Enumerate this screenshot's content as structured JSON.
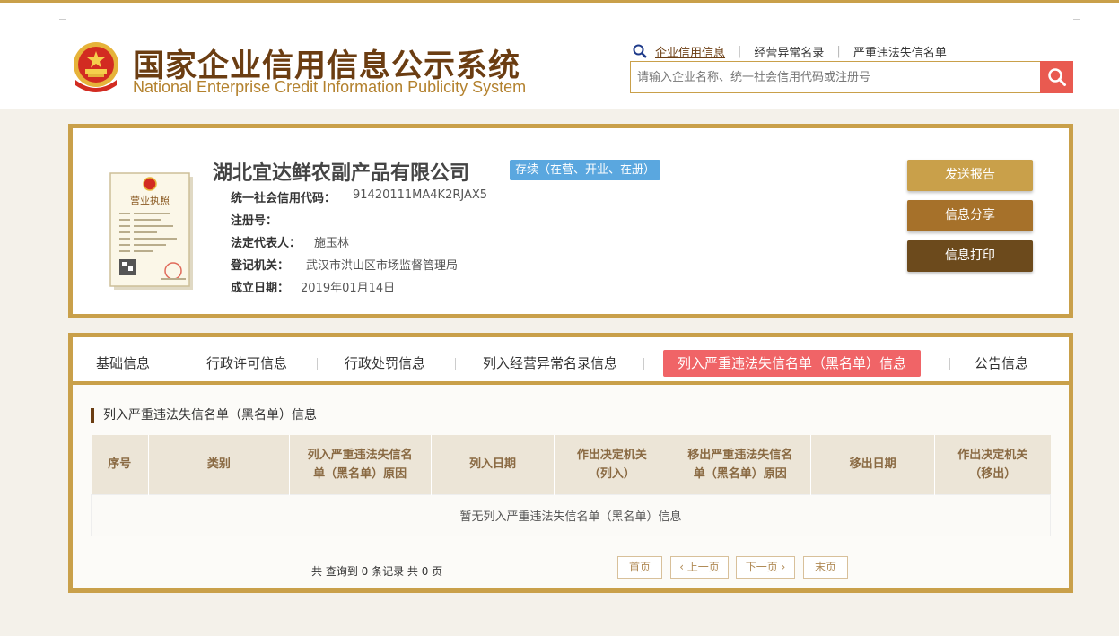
{
  "header": {
    "title_cn": "国家企业信用信息公示系统",
    "title_en": "National Enterprise Credit Information Publicity System",
    "links": [
      "企业信用信息",
      "经营异常名录",
      "严重违法失信名单"
    ],
    "search_placeholder": "请输入企业名称、统一社会信用代码或注册号"
  },
  "company": {
    "name": "湖北宜达鲜农副产品有限公司",
    "status": "存续（在营、开业、在册）",
    "license_text": "营业执照",
    "fields": [
      {
        "label": "统一社会信用代码：",
        "value": "91420111MA4K2RJAX5"
      },
      {
        "label": "注册号：",
        "value": ""
      },
      {
        "label": "法定代表人：",
        "value": "施玉林"
      },
      {
        "label": "登记机关：",
        "value": "武汉市洪山区市场监督管理局"
      },
      {
        "label": "成立日期：",
        "value": "2019年01月14日"
      }
    ],
    "buttons": [
      "发送报告",
      "信息分享",
      "信息打印"
    ]
  },
  "tabs": [
    "基础信息",
    "行政许可信息",
    "行政处罚信息",
    "列入经营异常名录信息",
    "列入严重违法失信名单（黑名单）信息",
    "公告信息"
  ],
  "active_tab": "列入严重违法失信名单（黑名单）信息",
  "section": {
    "title": "列入严重违法失信名单（黑名单）信息",
    "columns": [
      [
        "序号"
      ],
      [
        "类别"
      ],
      [
        "列入严重违法失信名",
        "单（黑名单）原因"
      ],
      [
        "列入日期"
      ],
      [
        "作出决定机关",
        "（列入）"
      ],
      [
        "移出严重违法失信名",
        "单（黑名单）原因"
      ],
      [
        "移出日期"
      ],
      [
        "作出决定机关",
        "（移出）"
      ]
    ],
    "empty_text": "暂无列入严重违法失信名单（黑名单）信息"
  },
  "pagination": {
    "info": "共 查询到 0 条记录 共 0 页",
    "first": "首页",
    "prev": "‹ 上一页",
    "next": "下一页 ›",
    "last": "末页"
  },
  "colors": {
    "gold": "#c9a04a",
    "brown": "#6b3d12",
    "status_blue": "#5aa7df",
    "active_tab": "#f06467",
    "search_red": "#e95a50"
  },
  "icons": [
    "national-emblem",
    "magnifier-icon",
    "search-icon",
    "license-image"
  ]
}
